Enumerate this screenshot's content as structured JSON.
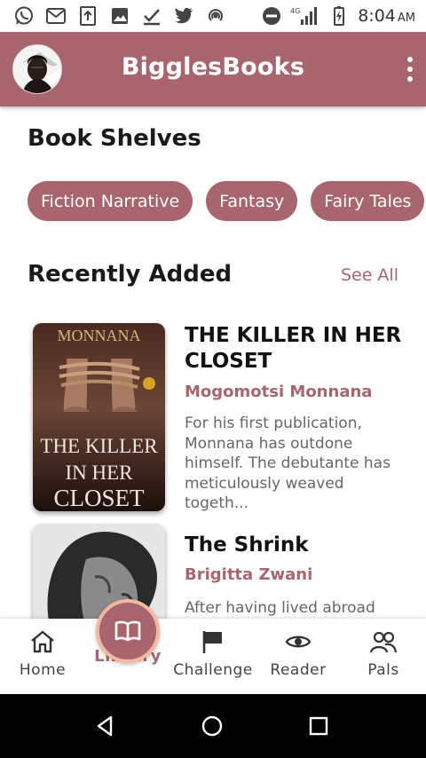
{
  "status_bar": {
    "time": "8:04",
    "ampm": "AM",
    "network": "4G",
    "left_icons": [
      "whatsapp-icon",
      "gmail-icon",
      "upload-icon",
      "image-icon",
      "check-download-icon",
      "twitter-icon",
      "wifi-hotspot-icon"
    ],
    "right_icons": [
      "do-not-disturb-icon",
      "signal-icon",
      "battery-charging-icon"
    ]
  },
  "app_bar": {
    "title": "BigglesBooks",
    "color": "#a8656d"
  },
  "shelves": {
    "title": "Book Shelves",
    "chips": [
      "Fiction Narrative",
      "Fantasy",
      "Fairy Tales"
    ]
  },
  "recent": {
    "title": "Recently Added",
    "see_all": "See All",
    "books": [
      {
        "title": "THE KILLER IN HER CLOSET",
        "author": "Mogomotsi Monnana",
        "description": "For his first publication, Monnana has outdone himself. The debutante has meticulously weaved togeth...",
        "cover_author": "MONNANA",
        "cover_title_lines": [
          "THE KILLER",
          "IN HER",
          "CLOSET"
        ]
      },
      {
        "title": "The Shrink",
        "author": "Brigitta Zwani",
        "description": "After having lived abroad"
      }
    ]
  },
  "bottom_nav": {
    "items": [
      {
        "label": "Home",
        "icon": "home-icon"
      },
      {
        "label": "Library",
        "icon": "book-open-icon",
        "active": true
      },
      {
        "label": "Challenge",
        "icon": "flag-icon"
      },
      {
        "label": "Reader",
        "icon": "eye-icon"
      },
      {
        "label": "Pals",
        "icon": "people-icon"
      }
    ]
  },
  "theme": {
    "accent": "#a8656d",
    "fab_ring": "#f2b8a0"
  }
}
